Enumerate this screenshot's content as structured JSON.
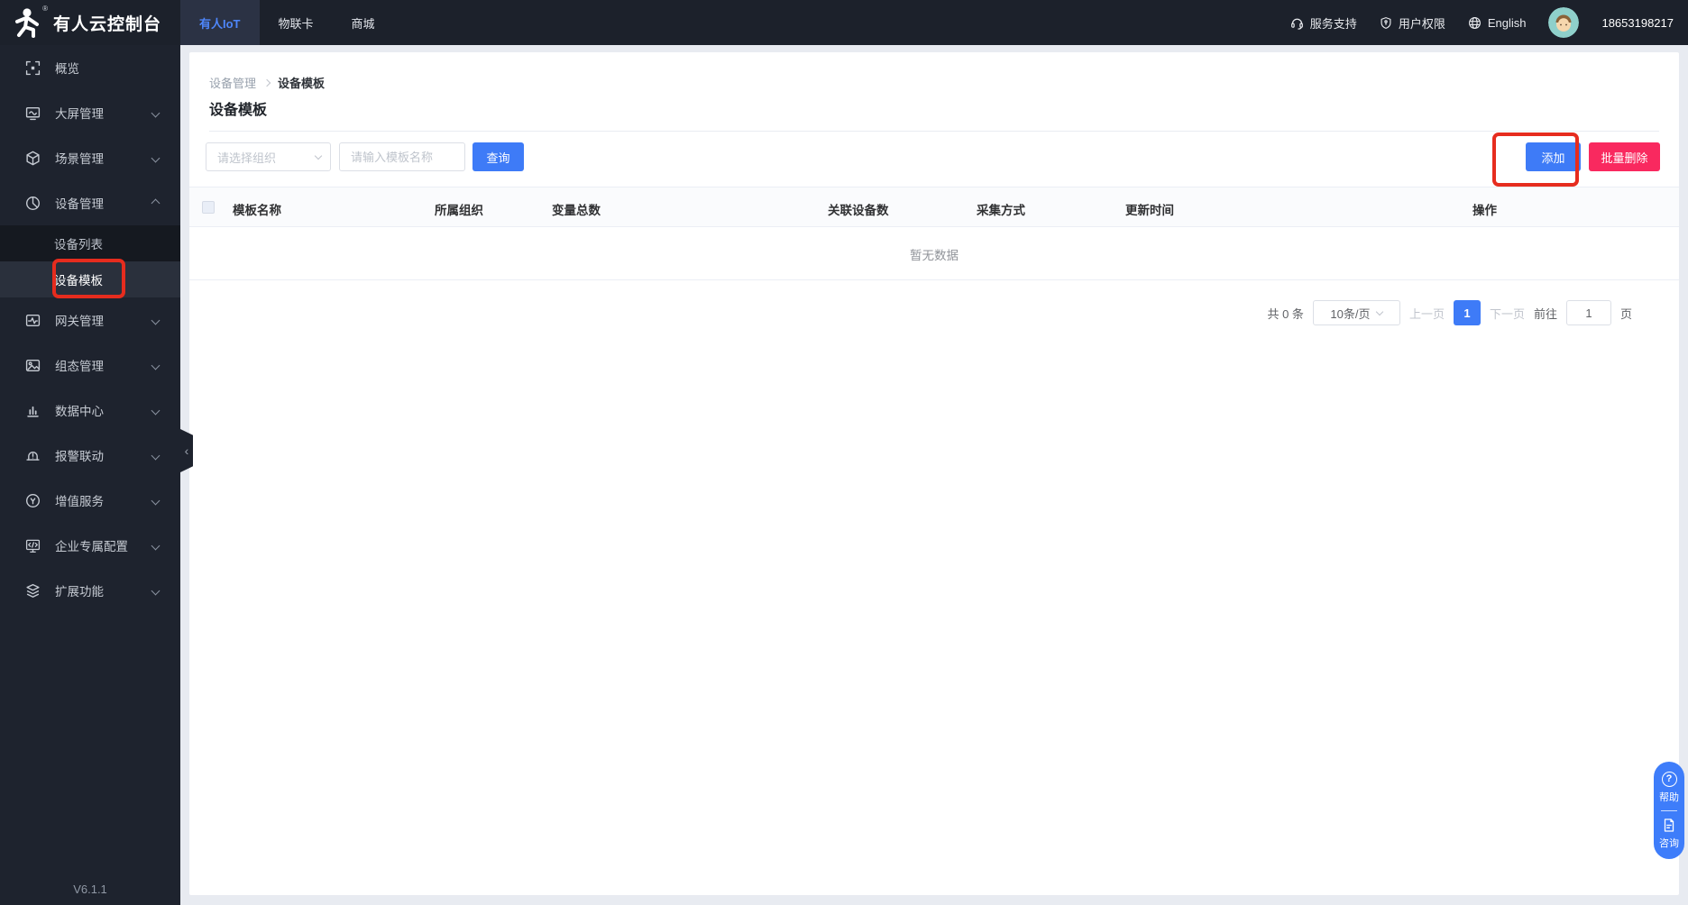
{
  "topbar": {
    "app_title": "有人云控制台",
    "tabs": [
      {
        "label": "有人IoT",
        "active": true
      },
      {
        "label": "物联卡",
        "active": false
      },
      {
        "label": "商城",
        "active": false
      }
    ],
    "support": "服务支持",
    "permissions": "用户权限",
    "language": "English",
    "phone": "18653198217"
  },
  "sidebar": {
    "items": [
      {
        "label": "概览",
        "icon": "overview-icon"
      },
      {
        "label": "大屏管理",
        "icon": "screen-icon",
        "expand": "down"
      },
      {
        "label": "场景管理",
        "icon": "scene-icon",
        "expand": "down"
      },
      {
        "label": "设备管理",
        "icon": "device-icon",
        "expand": "up",
        "children": [
          {
            "label": "设备列表",
            "active": false
          },
          {
            "label": "设备模板",
            "active": true,
            "annotated": true
          }
        ]
      },
      {
        "label": "网关管理",
        "icon": "gateway-icon",
        "expand": "down"
      },
      {
        "label": "组态管理",
        "icon": "scada-icon",
        "expand": "down"
      },
      {
        "label": "数据中心",
        "icon": "data-icon",
        "expand": "down"
      },
      {
        "label": "报警联动",
        "icon": "alarm-icon",
        "expand": "down"
      },
      {
        "label": "增值服务",
        "icon": "vas-icon",
        "expand": "down"
      },
      {
        "label": "企业专属配置",
        "icon": "enterprise-icon",
        "expand": "down"
      },
      {
        "label": "扩展功能",
        "icon": "extension-icon",
        "expand": "down"
      }
    ],
    "version": "V6.1.1"
  },
  "breadcrumb": [
    "设备管理",
    "设备模板"
  ],
  "page": {
    "title": "设备模板"
  },
  "toolbar": {
    "org_placeholder": "请选择组织",
    "name_placeholder": "请输入模板名称",
    "search_label": "查询",
    "add_label": "添加",
    "batch_delete_label": "批量删除"
  },
  "table": {
    "headers": [
      "模板名称",
      "所属组织",
      "变量总数",
      "关联设备数",
      "采集方式",
      "更新时间",
      "操作"
    ],
    "rows": [],
    "empty_text": "暂无数据"
  },
  "pagination": {
    "total": "共 0 条",
    "page_size": "10条/页",
    "prev": "上一页",
    "current_page": "1",
    "next": "下一页",
    "goto_label": "前往",
    "goto_value": "1",
    "page_unit": "页"
  },
  "float_menu": {
    "help": "帮助",
    "consult": "咨询"
  },
  "colors": {
    "primary_blue": "#3e7bf7",
    "danger_pink": "#f9295f",
    "annotation_red": "#e62c1e",
    "topbar_bg": "#1c212b",
    "sidebar_bg": "#1e232e",
    "submenu_bg": "#151920",
    "submenu_active_bg": "#2a303c",
    "avatar_bg": "#8fd0cb"
  }
}
